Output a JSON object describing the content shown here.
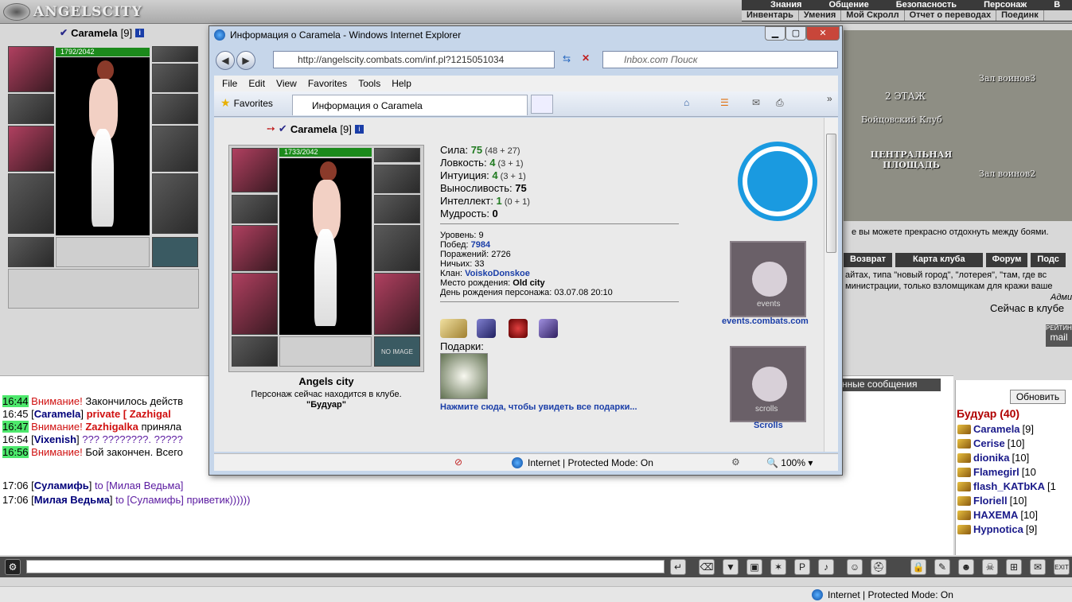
{
  "topbar": {
    "logo": "ANGELSCITY",
    "menu_row1": [
      "Знания",
      "Общение",
      "Безопасность",
      "Персонаж",
      "В"
    ],
    "menu_row2": [
      "Инвентарь",
      "Умения",
      "Мой Скролл",
      "Отчет о переводах",
      "Поединк"
    ]
  },
  "char": {
    "name": "Caramela",
    "level": "[9]",
    "hp": "1792/2042"
  },
  "city": {
    "floor": "2 ЭТАЖ",
    "club": "Бойцовский Клуб",
    "hall3": "Зал воинов3",
    "hall2": "Зал воинов2",
    "square": "ЦЕНТРАЛЬНАЯ ПЛОЩАДЬ",
    "rest_text": "е вы можете прекрасно отдохнуть между боями.",
    "buttons": [
      "Возврат",
      "Карта клуба",
      "Форум",
      "Подс"
    ],
    "notice1": "айтах, типа \"новый город\", \"лотерея\", \"там, где вс",
    "notice2": "министрации, только взломщикам для кражи ваше",
    "admin": "Адми",
    "in_club": "Сейчас в клубе",
    "rating": "РЕЙТИНГ",
    "mail": "mail"
  },
  "chat": {
    "tab": "нные сообщения",
    "lines": [
      {
        "time": "16:44",
        "warn": "Внимание!",
        "text": " Закончилось действ"
      },
      {
        "time": "16:45",
        "nick": "Caramela",
        "priv": "private [ Zazhigal"
      },
      {
        "time": "16:47",
        "warn": "Внимание!",
        "nick": "Zazhigalka",
        "text": " приняла"
      },
      {
        "time": "16:54",
        "nick": "Vixenish",
        "text": " ??? ????????. ?????"
      },
      {
        "time": "16:56",
        "warn": "Внимание!",
        "text": " Бой закончен. Всего"
      },
      {
        "time": "17:06",
        "nick": "Суламифь",
        "to": " to [Милая Ведьма]"
      },
      {
        "time": "17:06",
        "nick": "Милая Ведьма",
        "to": " to [Суламифь] приветик))))))"
      }
    ]
  },
  "userlist": {
    "refresh": "Обновить",
    "room": "Будуар (40)",
    "users": [
      {
        "name": "Caramela",
        "lv": "[9]"
      },
      {
        "name": "Cerise",
        "lv": "[10]"
      },
      {
        "name": "dionika",
        "lv": "[10]"
      },
      {
        "name": "Flamegirl",
        "lv": "[10"
      },
      {
        "name": "flash_KATbKA",
        "lv": "[1"
      },
      {
        "name": "Floriell",
        "lv": "[10]"
      },
      {
        "name": "HAXEMA",
        "lv": "[10]"
      },
      {
        "name": "Hypnotica",
        "lv": "[9]"
      }
    ]
  },
  "statusbar": {
    "zone": "Internet | Protected Mode: On"
  },
  "ie": {
    "title": "Информация о Caramela - Windows Internet Explorer",
    "url": "http://angelscity.combats.com/inf.pl?1215051034",
    "search_placeholder": "Inbox.com Поиск",
    "menu": [
      "File",
      "Edit",
      "View",
      "Favorites",
      "Tools",
      "Help"
    ],
    "favorites": "Favorites",
    "tab_title": "Информация о Caramela",
    "status_zone": "Internet | Protected Mode: On",
    "zoom": "100%"
  },
  "profile": {
    "name": "Caramela",
    "level": "[9]",
    "hp": "1733/2042",
    "city": "Angels city",
    "location_text": "Персонаж сейчас находится в клубе.",
    "location_room": "\"Будуар\"",
    "stats": [
      {
        "label": "Сила: ",
        "value": "75",
        "extra": " (48 + 27)"
      },
      {
        "label": "Ловкость: ",
        "value": "4",
        "extra": " (3 + 1)"
      },
      {
        "label": "Интуиция: ",
        "value": "4",
        "extra": " (3 + 1)"
      },
      {
        "label": "Выносливость: ",
        "value": "75",
        "extra": ""
      },
      {
        "label": "Интеллект: ",
        "value": "1",
        "extra": " (0 + 1)"
      },
      {
        "label": "Мудрость: ",
        "value": "0",
        "extra": ""
      }
    ],
    "level_line": "Уровень: 9",
    "wins_label": "Побед: ",
    "wins": "7984",
    "losses": "Поражений: 2726",
    "draws": "Ничьих: 33",
    "clan_label": "Клан: ",
    "clan": "VoiskoDonskoe",
    "birthplace_label": "Место рождения: ",
    "birthplace": "Old city",
    "birthday": "День рождения персонажа: 03.07.08 20:10",
    "gifts_label": "Подарки:",
    "gifts_link": "Нажмите сюда, чтобы увидеть все подарки...",
    "events_link": "events.combats.com",
    "events_word": "events",
    "scrolls_word": "scrolls",
    "scrolls_link": "Scrolls",
    "no_image": "NO IMAGE"
  }
}
